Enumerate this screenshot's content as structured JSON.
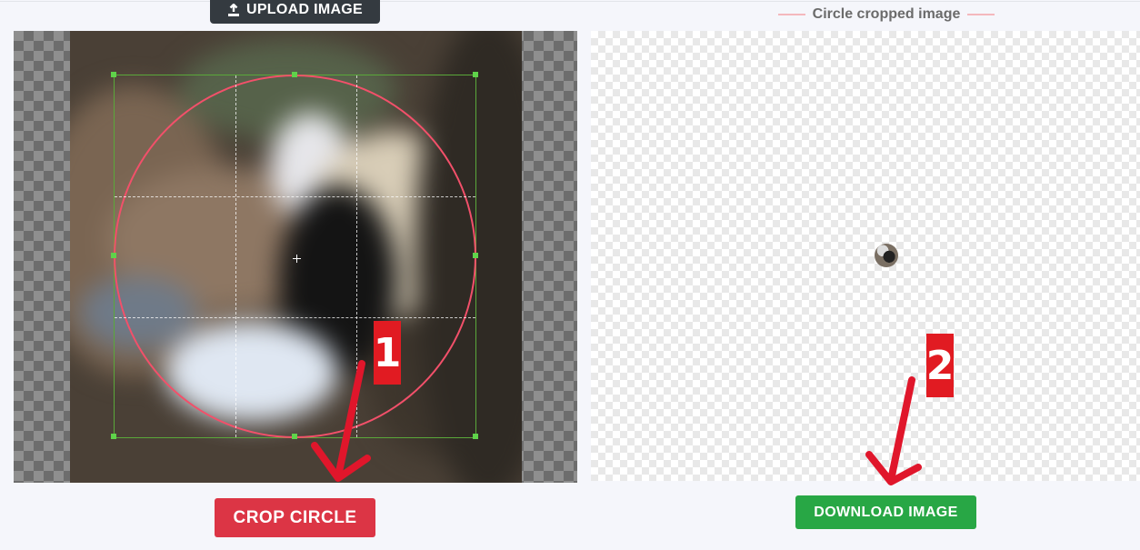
{
  "toolbar": {
    "upload_label": "UPLOAD IMAGE"
  },
  "editor": {
    "crop_label": "CROP CIRCLE"
  },
  "result": {
    "title": "Circle cropped image",
    "download_label": "DOWNLOAD IMAGE"
  },
  "annotations": {
    "step1": "1",
    "step2": "2",
    "arrow_color": "#e0162b"
  },
  "colors": {
    "crop_button": "#dc3545",
    "download_button": "#28a745",
    "upload_button": "#343a40",
    "crop_circle": "#f2506a",
    "crop_box": "#5aa83a"
  },
  "icons": {
    "upload": "upload-icon"
  }
}
